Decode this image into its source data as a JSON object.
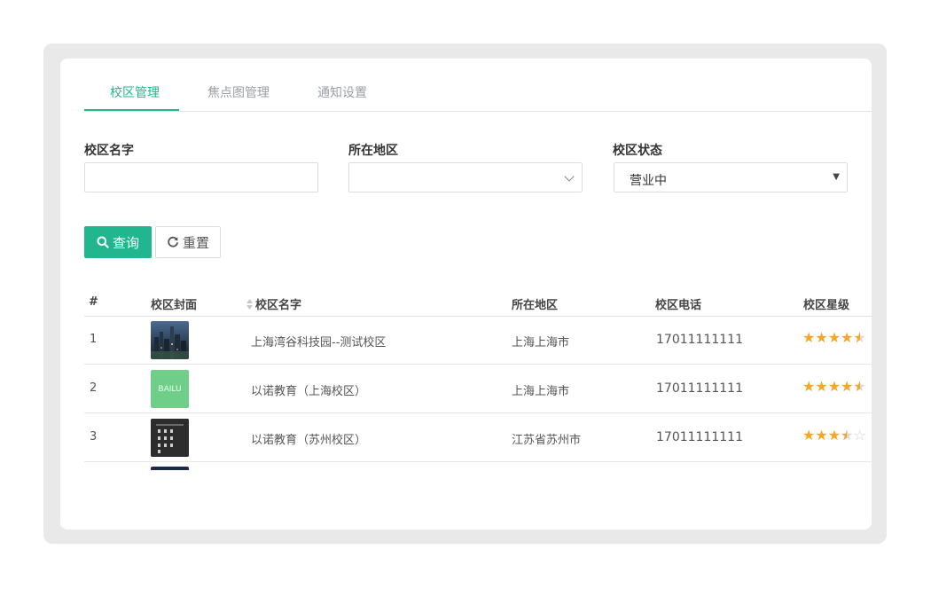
{
  "tabs": [
    {
      "label": "校区管理",
      "active": true
    },
    {
      "label": "焦点图管理",
      "active": false
    },
    {
      "label": "通知设置",
      "active": false
    }
  ],
  "filters": {
    "name_label": "校区名字",
    "name_value": "",
    "region_label": "所在地区",
    "region_value": "",
    "status_label": "校区状态",
    "status_value": "营业中"
  },
  "buttons": {
    "query": "查询",
    "reset": "重置"
  },
  "table": {
    "headers": {
      "index": "#",
      "cover": "校区封面",
      "name": "校区名字",
      "region": "所在地区",
      "phone": "校区电话",
      "rating": "校区星级"
    },
    "rows": [
      {
        "index": "1",
        "cover": "city-photo",
        "name": "上海湾谷科技园--测试校区",
        "region": "上海上海市",
        "phone": "17011111111",
        "rating": 4.5
      },
      {
        "index": "2",
        "cover_text": "BAILU",
        "name": "以诺教育（上海校区）",
        "region": "上海上海市",
        "phone": "17011111111",
        "rating": 4.5
      },
      {
        "index": "3",
        "cover": "dark-text-poster",
        "name": "以诺教育（苏州校区）",
        "region": "江苏省苏州市",
        "phone": "17011111111",
        "rating": 3.5
      }
    ]
  },
  "colors": {
    "accent": "#22b68f",
    "star": "#f5a623"
  }
}
